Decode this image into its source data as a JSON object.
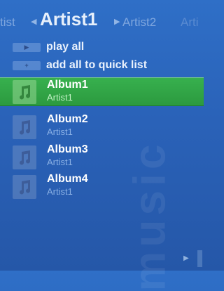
{
  "pivot": {
    "prev_label": "tist",
    "current_label": "Artist1",
    "next_label": "Artist2",
    "next2_label": "Arti"
  },
  "actions": [
    {
      "label": "play all",
      "icon": "play-icon"
    },
    {
      "label": "add all to quick list",
      "icon": "plus-icon"
    }
  ],
  "albums": [
    {
      "title": "Album1",
      "artist": "Artist1",
      "selected": true
    },
    {
      "title": "Album2",
      "artist": "Artist1",
      "selected": false
    },
    {
      "title": "Album3",
      "artist": "Artist1",
      "selected": false
    },
    {
      "title": "Album4",
      "artist": "Artist1",
      "selected": false
    }
  ],
  "watermark": "music",
  "colors": {
    "background": "#2a62b8",
    "selection": "#33a84a"
  }
}
